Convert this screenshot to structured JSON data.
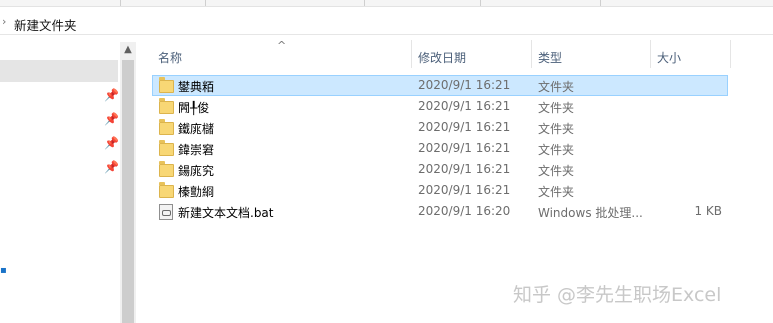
{
  "address": {
    "current_folder": "新建文件夹"
  },
  "columns": {
    "name": "名称",
    "date": "修改日期",
    "type": "类型",
    "size": "大小"
  },
  "files": [
    {
      "name": "鐢典粨",
      "date": "2020/9/1 16:21",
      "type": "文件夹",
      "size": "",
      "icon": "folder-icon",
      "selected": true
    },
    {
      "name": "闁╀俊",
      "date": "2020/9/1 16:21",
      "type": "文件夹",
      "size": "",
      "icon": "folder-icon"
    },
    {
      "name": "鐵庣櫧",
      "date": "2020/9/1 16:21",
      "type": "文件夹",
      "size": "",
      "icon": "folder-icon"
    },
    {
      "name": "鍏崇窘",
      "date": "2020/9/1 16:21",
      "type": "文件夹",
      "size": "",
      "icon": "folder-icon"
    },
    {
      "name": "鍚庣究",
      "date": "2020/9/1 16:21",
      "type": "文件夹",
      "size": "",
      "icon": "folder-icon"
    },
    {
      "name": "榛勯綗",
      "date": "2020/9/1 16:21",
      "type": "文件夹",
      "size": "",
      "icon": "folder-icon"
    },
    {
      "name": "新建文本文档.bat",
      "date": "2020/9/1 16:20",
      "type": "Windows 批处理...",
      "size": "1 KB",
      "icon": "batch-file-icon"
    }
  ],
  "watermark": "知乎 @李先生职场Excel",
  "colors": {
    "selection": "#cce8ff",
    "selection_border": "#99d1ff",
    "folder": "#f8d775"
  }
}
